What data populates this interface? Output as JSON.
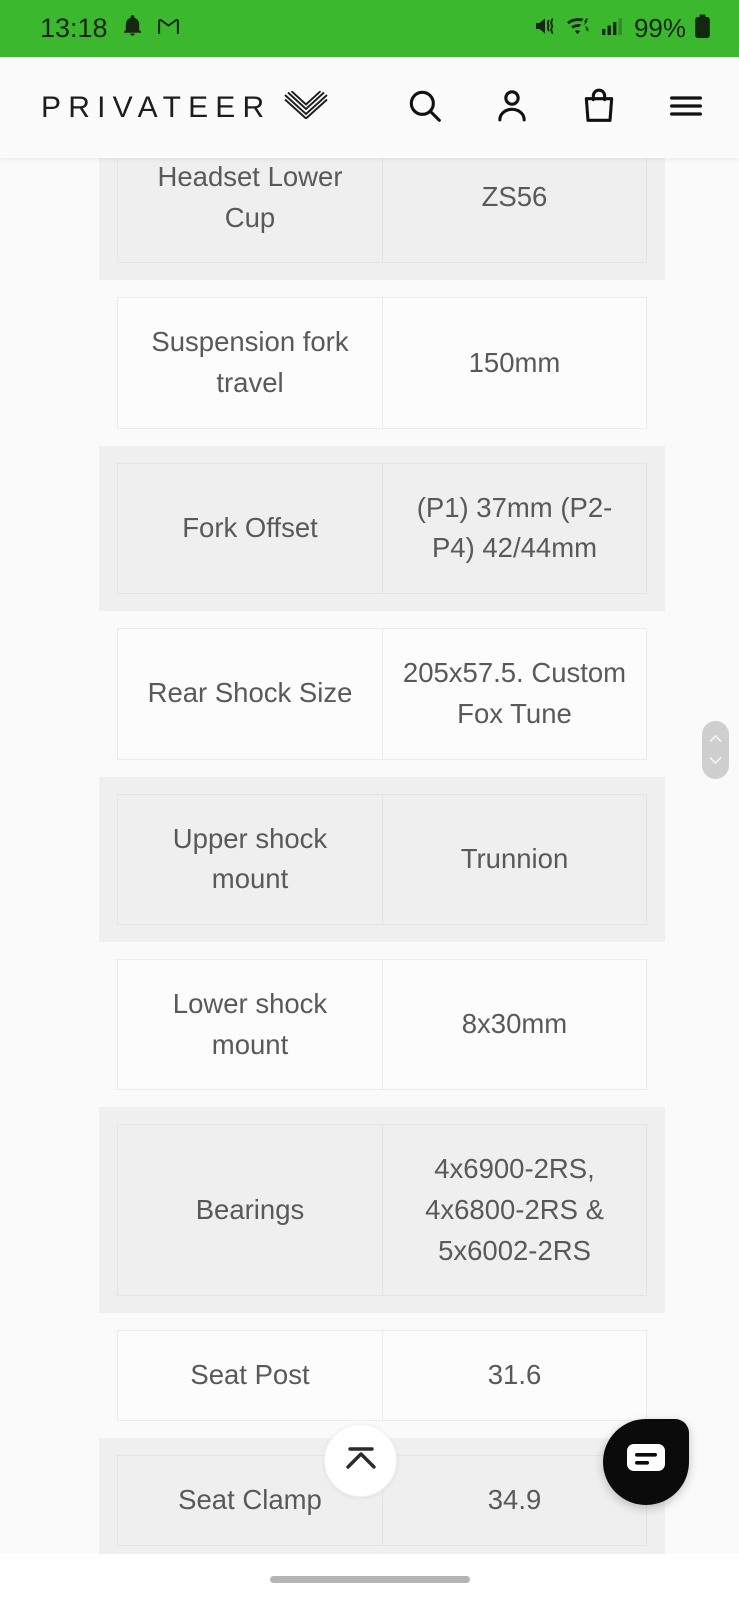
{
  "status_bar": {
    "time": "13:18",
    "battery_percent": "99%",
    "icons": [
      "notification-bell-icon",
      "gmail-icon",
      "mute-vibrate-icon",
      "wifi-icon",
      "cellular-signal-icon",
      "battery-icon"
    ],
    "background_color": "#3cb82e"
  },
  "header": {
    "brand": "PRIVATEER",
    "brand_mark": "chevron-stripes-icon",
    "actions": [
      {
        "name": "search-button",
        "icon": "search-icon"
      },
      {
        "name": "account-button",
        "icon": "user-icon"
      },
      {
        "name": "cart-button",
        "icon": "shopping-bag-icon"
      },
      {
        "name": "menu-button",
        "icon": "hamburger-menu-icon"
      }
    ]
  },
  "spec_table": {
    "rows": [
      {
        "label": "Headset Lower Cup",
        "value": "ZS56"
      },
      {
        "label": "Suspension fork travel",
        "value": "150mm"
      },
      {
        "label": "Fork Offset",
        "value": "(P1) 37mm (P2-P4) 42/44mm"
      },
      {
        "label": "Rear Shock Size",
        "value": "205x57.5. Custom Fox Tune"
      },
      {
        "label": "Upper shock mount",
        "value": "Trunnion"
      },
      {
        "label": "Lower shock mount",
        "value": "8x30mm"
      },
      {
        "label": "Bearings",
        "value": "4x6900-2RS, 4x6800-2RS & 5x6002-2RS"
      },
      {
        "label": "Seat Post",
        "value": "31.6"
      },
      {
        "label": "Seat Clamp",
        "value": "34.9"
      }
    ]
  },
  "controls": {
    "scroll_handle": {
      "up_icon": "chevron-up-icon",
      "down_icon": "chevron-down-icon"
    },
    "scroll_to_top": {
      "icon": "scroll-to-top-icon"
    },
    "chat_fab": {
      "icon": "chat-bubble-icon",
      "color": "#0b0b0b"
    }
  },
  "nav_bar": {
    "gesture_pill": "gesture-pill"
  }
}
